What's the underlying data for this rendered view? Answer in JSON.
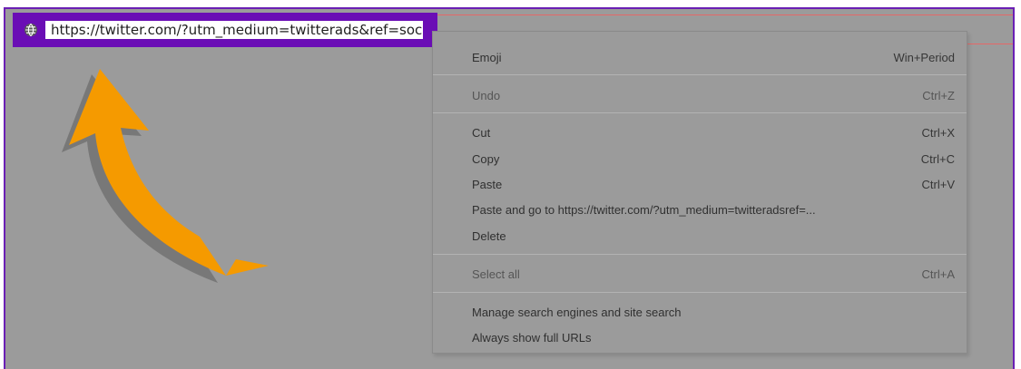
{
  "browser": {
    "address_url": "https://twitter.com/?utm_medium=twitterads&ref=socia",
    "globe_icon": "globe-icon"
  },
  "context_menu": {
    "items": [
      {
        "label": "Emoji",
        "shortcut": "Win+Period"
      },
      {
        "label": "Undo",
        "shortcut": "Ctrl+Z"
      },
      {
        "label": "Cut",
        "shortcut": "Ctrl+X"
      },
      {
        "label": "Copy",
        "shortcut": "Ctrl+C"
      },
      {
        "label": "Paste",
        "shortcut": "Ctrl+V"
      },
      {
        "label": "Paste and go to https://twitter.com/?utm_medium=twitteradsref=...",
        "shortcut": ""
      },
      {
        "label": "Delete",
        "shortcut": ""
      },
      {
        "label": "Select all",
        "shortcut": "Ctrl+A"
      },
      {
        "label": "Manage search engines and site search",
        "shortcut": ""
      },
      {
        "label": "Always show full URLs",
        "shortcut": ""
      }
    ]
  },
  "colors": {
    "frame_border": "#6a1fb4",
    "address_highlight": "#6a0db5",
    "background_gray": "#9b9b9b",
    "arrow_orange": "#f59a00"
  },
  "annotations": {
    "arrow_icon": "arrow-icon"
  }
}
